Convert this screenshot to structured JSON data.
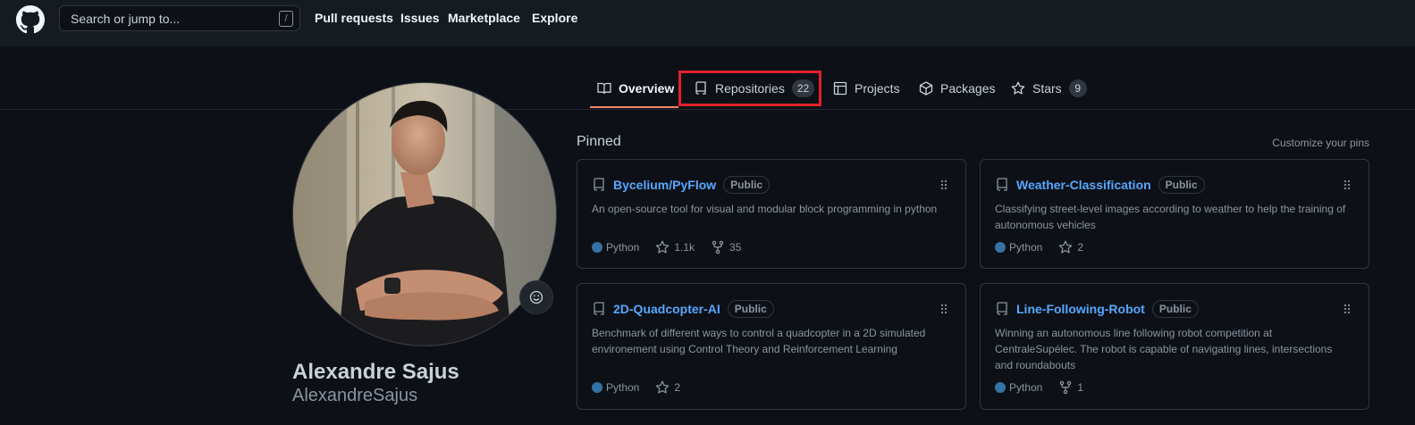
{
  "header": {
    "search_placeholder": "Search or jump to...",
    "search_shortcut": "/",
    "nav": [
      "Pull requests",
      "Issues",
      "Marketplace",
      "Explore"
    ]
  },
  "tabs": [
    {
      "label": "Overview",
      "icon": "book-icon",
      "active": true
    },
    {
      "label": "Repositories",
      "icon": "repo-icon",
      "count": "22"
    },
    {
      "label": "Projects",
      "icon": "table-icon"
    },
    {
      "label": "Packages",
      "icon": "package-icon"
    },
    {
      "label": "Stars",
      "icon": "star-icon",
      "count": "9"
    }
  ],
  "profile": {
    "fullname": "Alexandre Sajus",
    "username": "AlexandreSajus"
  },
  "pinned": {
    "title": "Pinned",
    "customize": "Customize your pins",
    "cards": [
      {
        "name": "Bycelium/PyFlow",
        "visibility": "Public",
        "desc": "An open-source tool for visual and modular block programming in python",
        "lang": "Python",
        "stars": "1.1k",
        "forks": "35"
      },
      {
        "name": "Weather-Classification",
        "visibility": "Public",
        "desc": "Classifying street-level images according to weather to help the training of autonomous vehicles",
        "lang": "Python",
        "stars": "2"
      },
      {
        "name": "2D-Quadcopter-AI",
        "visibility": "Public",
        "desc": "Benchmark of different ways to control a quadcopter in a 2D simulated environement using Control Theory and Reinforcement Learning",
        "lang": "Python",
        "stars": "2"
      },
      {
        "name": "Line-Following-Robot",
        "visibility": "Public",
        "desc": "Winning an autonomous line following robot competition at CentraleSupélec. The robot is capable of navigating lines, intersections and roundabouts",
        "lang": "Python",
        "forks": "1"
      }
    ]
  },
  "colors": {
    "accent": "#f78166",
    "link": "#58a6ff",
    "python": "#3572A5",
    "highlight": "#e0212b"
  }
}
